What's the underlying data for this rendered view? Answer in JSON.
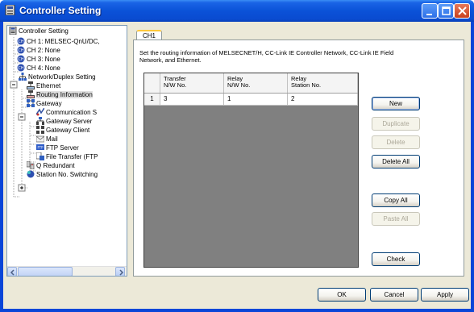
{
  "window": {
    "title": "Controller Setting"
  },
  "tree": {
    "items": [
      {
        "label": "Controller Setting",
        "icon": "plc-icon"
      },
      {
        "label": "CH 1: MELSEC-QnU/DC,",
        "icon": "channel-icon"
      },
      {
        "label": "CH 2: None",
        "icon": "channel-icon"
      },
      {
        "label": "CH 3: None",
        "icon": "channel-icon"
      },
      {
        "label": "CH 4: None",
        "icon": "channel-icon"
      },
      {
        "label": "Network/Duplex Setting",
        "icon": "network-icon"
      },
      {
        "label": "Ethernet",
        "icon": "computer-icon"
      },
      {
        "label": "Routing Information",
        "icon": "routing-icon"
      },
      {
        "label": "Gateway",
        "icon": "gateway-icon"
      },
      {
        "label": "Communication S",
        "icon": "communication-icon"
      },
      {
        "label": "Gateway Server",
        "icon": "server-icon"
      },
      {
        "label": "Gateway Client",
        "icon": "client-icon"
      },
      {
        "label": "Mail",
        "icon": "mail-icon"
      },
      {
        "label": "FTP Server",
        "icon": "ftp-icon"
      },
      {
        "label": "File Transfer (FTP",
        "icon": "file-transfer-icon"
      },
      {
        "label": "Q Redundant",
        "icon": "redundant-icon"
      },
      {
        "label": "Station No. Switching",
        "icon": "station-icon"
      }
    ],
    "selected": "Routing Information"
  },
  "tab": {
    "label": "CH1"
  },
  "description": "Set the routing information of MELSECNET/H, CC-Link IE Controller Network, CC-Link IE Field Network, and Ethernet.",
  "grid": {
    "columns": [
      "Transfer\nN/W No.",
      "Relay\nN/W No.",
      "Relay\nStation No."
    ],
    "rows": [
      {
        "num": "1",
        "cells": [
          "3",
          "1",
          "2"
        ]
      }
    ]
  },
  "buttons": {
    "new": "New",
    "duplicate": "Duplicate",
    "delete": "Delete",
    "delete_all": "Delete All",
    "copy_all": "Copy All",
    "paste_all": "Paste All",
    "check": "Check",
    "ok": "OK",
    "cancel": "Cancel",
    "apply": "Apply"
  },
  "colors": {
    "title_blue": "#0a4bd0",
    "client_bg": "#ece9d8",
    "grid_bg": "#808080",
    "tab_accent": "#ffc83c"
  }
}
